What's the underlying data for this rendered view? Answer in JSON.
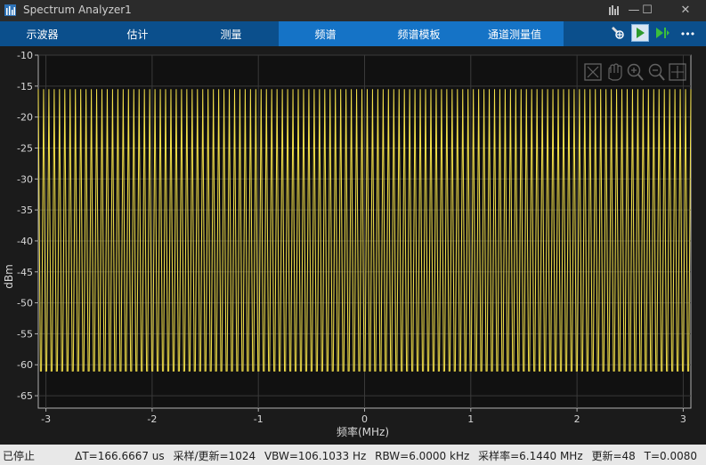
{
  "window": {
    "title": "Spectrum Analyzer1",
    "minimize": "—",
    "maximize": "☐",
    "close": "✕"
  },
  "tabs": [
    {
      "label": "示波器"
    },
    {
      "label": "估计"
    },
    {
      "label": "测量"
    },
    {
      "label": "频谱"
    },
    {
      "label": "频谱模板"
    },
    {
      "label": "通道测量值"
    }
  ],
  "toolbar": {
    "more_label": "•••"
  },
  "colors": {
    "trace": "#f5e24a",
    "tab_bar": "#0b4f8c",
    "tab_active": "#1573c6",
    "plot_bg": "#111111"
  },
  "axes": {
    "ylabel": "dBm",
    "xlabel": "频率(MHz)",
    "yticks": [
      "-10",
      "-15",
      "-20",
      "-25",
      "-30",
      "-35",
      "-40",
      "-45",
      "-50",
      "-55",
      "-60",
      "-65"
    ],
    "xticks": [
      "-3",
      "-2",
      "-1",
      "0",
      "1",
      "2",
      "3"
    ]
  },
  "chart_data": {
    "type": "line",
    "xlabel": "频率(MHz)",
    "ylabel": "dBm",
    "xlim": [
      -3.072,
      3.072
    ],
    "ylim": [
      -67,
      -10
    ],
    "grid": true,
    "series": [
      {
        "color": "#f5e24a",
        "peak_dbm": -15.5,
        "trough_dbm": -61,
        "peak_count": 123
      }
    ]
  },
  "status": {
    "state": "已停止",
    "delta_t": "ΔT=166.6667 us",
    "samples_per_update": "采样/更新=1024",
    "vbw": "VBW=106.1033 Hz",
    "rbw": "RBW=6.0000 kHz",
    "sample_rate": "采样率=6.1440 MHz",
    "updates": "更新=48",
    "time": "T=0.0080"
  }
}
